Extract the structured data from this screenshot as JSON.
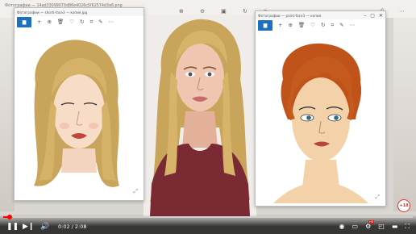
{
  "background_window": {
    "title": "Фотографии — 14ad33099070d86e4026c5f62574d3a6.png",
    "toolbar_icons": [
      "zoom-in-icon",
      "zoom-out-icon",
      "image-icon",
      "rotate-icon",
      "crop-icon"
    ],
    "window_icons": [
      "print-icon",
      "more-icon"
    ]
  },
  "left_window": {
    "title": "Фотографии — shorti-face3 — копия.jpg",
    "toolbar_icons": [
      "add-icon",
      "zoom-in-icon",
      "delete-icon",
      "heart-icon",
      "rotate-icon",
      "crop-icon",
      "edit-icon",
      "more-icon"
    ]
  },
  "right_window": {
    "title": "Фотографии — point-face3 — копия",
    "window_buttons": [
      "minimize",
      "maximize",
      "close"
    ],
    "toolbar_icons": [
      "add-icon",
      "zoom-in-icon",
      "delete-icon",
      "heart-icon",
      "rotate-icon",
      "crop-icon",
      "edit-icon",
      "more-icon"
    ]
  },
  "player": {
    "time": "0:02 / 2:08",
    "progress_fraction": 0.016,
    "progress_color": "#ff0000",
    "buttons": [
      "pause",
      "next",
      "volume",
      "settings",
      "miniplayer",
      "theater",
      "fullscreen"
    ]
  },
  "badge_text": "+18",
  "colors": {
    "accent_blue": "#1f6fbf",
    "hair_left": "#c9a45b",
    "hair_right": "#c0531a",
    "dress": "#7a2a33"
  }
}
